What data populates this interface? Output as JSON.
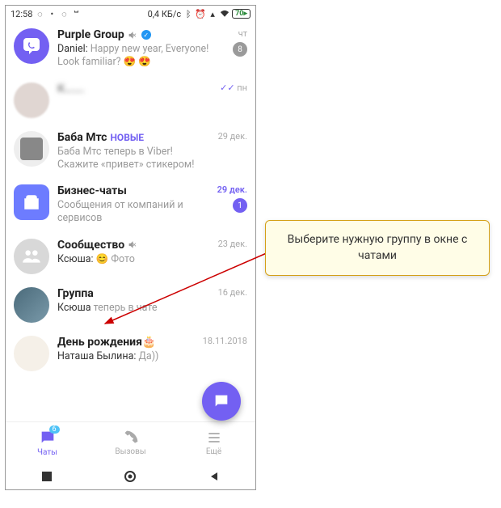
{
  "statusbar": {
    "time": "12:58",
    "net": "0,4 КБ/с",
    "battery": "70"
  },
  "chats": [
    {
      "title": "Purple Group",
      "muted": true,
      "verified": true,
      "senderPrefix": "Daniel:",
      "msg": " Happy new year, Everyone! Look familiar? 😍 😍",
      "time": "чт",
      "badge": "8"
    },
    {
      "title": "К…….",
      "msg": "",
      "time": "пн",
      "tick": "✓✓",
      "blur": true
    },
    {
      "title": "Баба Мтс",
      "newtag": "НОВЫЕ",
      "msg": "Баба Мтс теперь в Viber! Скажите «привет» стикером!",
      "time": "29 дек."
    },
    {
      "title": "Бизнес-чаты",
      "msg": "Сообщения от компаний и сервисов",
      "time": "29 дек.",
      "badge": "1",
      "badgePurple": true,
      "timePurple": true
    },
    {
      "title": "Сообщество",
      "muted": true,
      "senderPrefix": "Ксюша:",
      "msg": " 😊 Фото",
      "time": "23 дек."
    },
    {
      "title": "Группа",
      "senderPrefix": "Ксюша",
      "msg": " теперь в чате",
      "time": "16 дек."
    },
    {
      "title": "День рождения🎂",
      "senderPrefix": "Наташа Былина:",
      "msg": " Да))",
      "time": "18.11.2018"
    }
  ],
  "nav": {
    "chats": "Чаты",
    "chatsBadge": "6",
    "calls": "Вызовы",
    "more": "Ещё"
  },
  "callout": "Выберите нужную группу в окне с чатами"
}
